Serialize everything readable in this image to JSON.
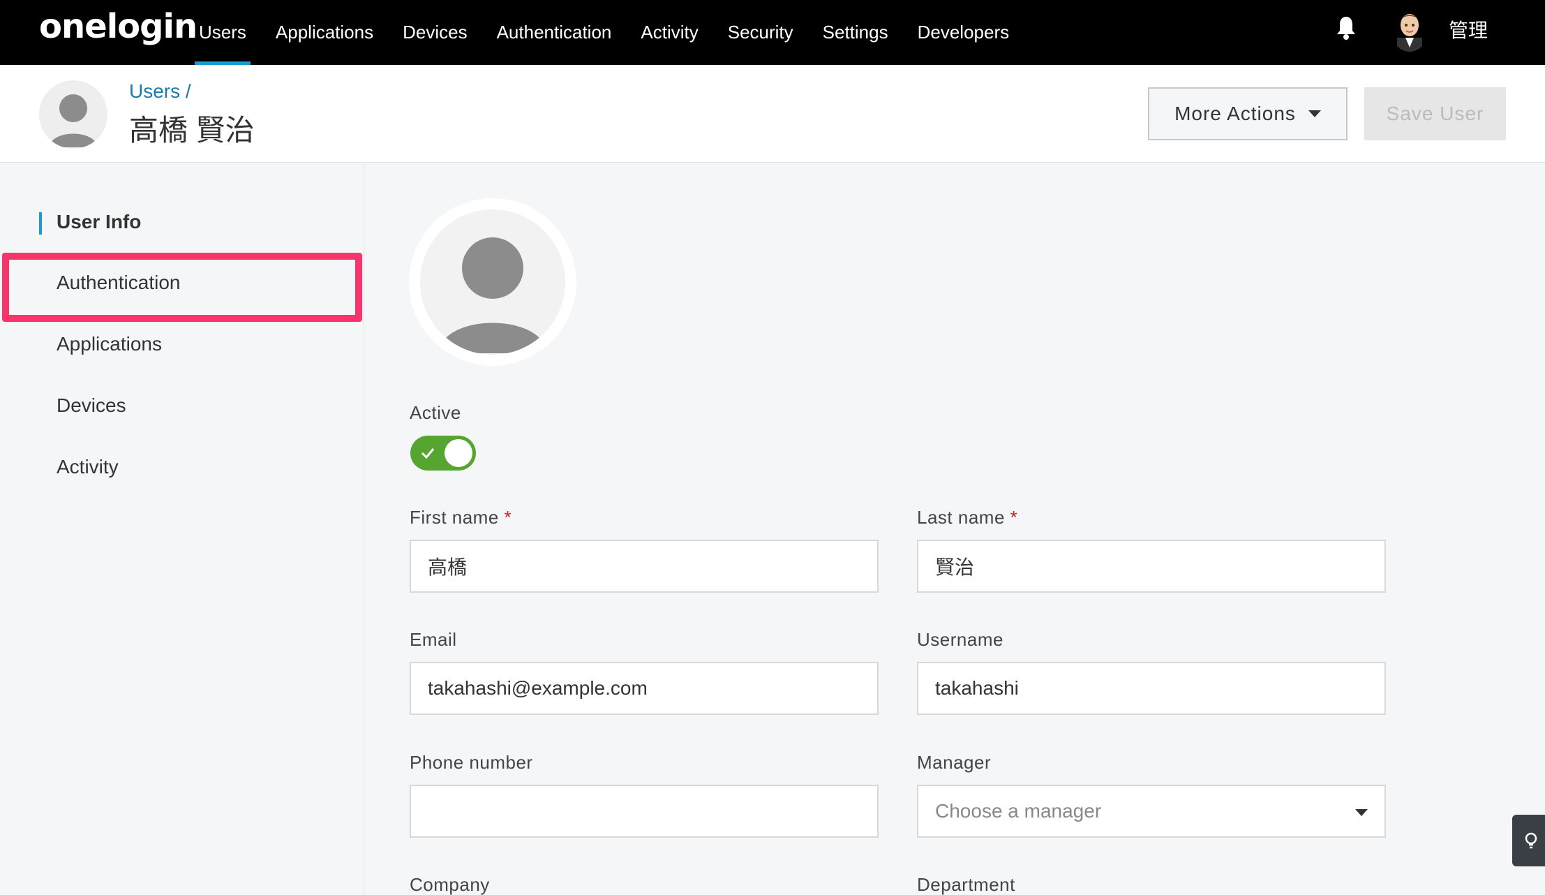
{
  "nav": {
    "logo": "onelogin",
    "items": [
      {
        "label": "Users",
        "active": true
      },
      {
        "label": "Applications",
        "active": false
      },
      {
        "label": "Devices",
        "active": false
      },
      {
        "label": "Authentication",
        "active": false
      },
      {
        "label": "Activity",
        "active": false
      },
      {
        "label": "Security",
        "active": false
      },
      {
        "label": "Settings",
        "active": false
      },
      {
        "label": "Developers",
        "active": false
      }
    ],
    "user_name": "管理",
    "accent_color": "#1a9bd7"
  },
  "header": {
    "breadcrumb": "Users /",
    "title": "高橋 賢治",
    "more_actions_label": "More Actions",
    "save_label": "Save User"
  },
  "sidebar": {
    "items": [
      {
        "label": "User Info",
        "active": true
      },
      {
        "label": "Authentication",
        "active": false,
        "highlighted": true
      },
      {
        "label": "Applications",
        "active": false
      },
      {
        "label": "Devices",
        "active": false
      },
      {
        "label": "Activity",
        "active": false
      }
    ],
    "highlight_color": "#f7346c"
  },
  "form": {
    "active_label": "Active",
    "active_value": true,
    "first_name_label": "First name",
    "first_name_value": "高橋",
    "last_name_label": "Last name",
    "last_name_value": "賢治",
    "required_mark": "*",
    "email_label": "Email",
    "email_value": "takahashi@example.com",
    "username_label": "Username",
    "username_value": "takahashi",
    "phone_label": "Phone number",
    "phone_value": "",
    "manager_label": "Manager",
    "manager_placeholder": "Choose a manager",
    "company_label": "Company",
    "department_label": "Department",
    "toggle_color": "#55a530"
  }
}
